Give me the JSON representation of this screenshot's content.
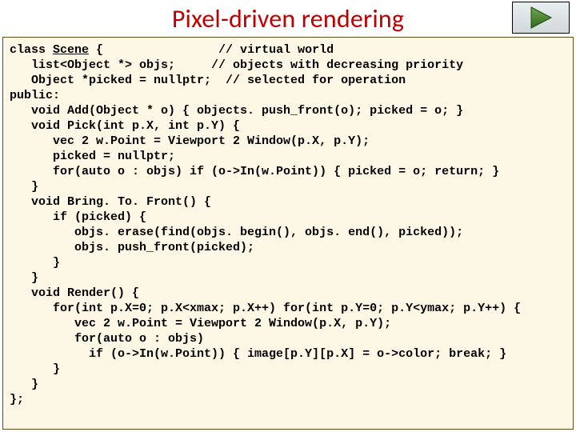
{
  "title": "Pixel-driven rendering",
  "play_icon": "play-icon",
  "code": {
    "l01a": "class ",
    "l01b": "Scene",
    "l01c": " {                // virtual world",
    "l02": "   list<Object *> objs;     // objects with decreasing priority",
    "l03": "   Object *picked = nullptr;  // selected for operation",
    "l04": "public:",
    "l05": "   void Add(Object * o) { objects. push_front(o); picked = o; }",
    "l06": "   void Pick(int p.X, int p.Y) {",
    "l07": "      vec 2 w.Point = Viewport 2 Window(p.X, p.Y);",
    "l08": "      picked = nullptr;",
    "l09": "      for(auto o : objs) if (o->In(w.Point)) { picked = o; return; }",
    "l10": "   }",
    "l11": "   void Bring. To. Front() {",
    "l12": "      if (picked) {",
    "l13": "         objs. erase(find(objs. begin(), objs. end(), picked));",
    "l14": "         objs. push_front(picked);",
    "l15": "      }",
    "l16": "   }",
    "l17": "   void Render() {",
    "l18": "      for(int p.X=0; p.X<xmax; p.X++) for(int p.Y=0; p.Y<ymax; p.Y++) {",
    "l19": "         vec 2 w.Point = Viewport 2 Window(p.X, p.Y);",
    "l20": "         for(auto o : objs)",
    "l21": "           if (o->In(w.Point)) { image[p.Y][p.X] = o->color; break; }",
    "l22": "      }",
    "l23": "   }",
    "l24": "};"
  }
}
